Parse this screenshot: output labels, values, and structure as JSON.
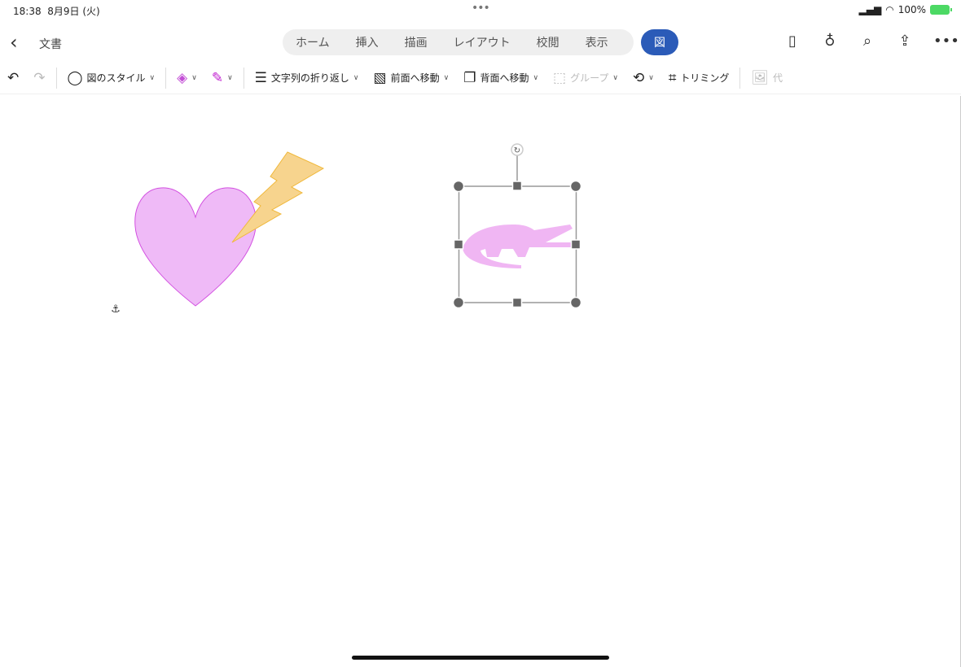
{
  "status": {
    "time": "18:38",
    "date": "8月9日 (火)",
    "battery": "100%"
  },
  "header": {
    "doc_title": "文書",
    "tabs": [
      "ホーム",
      "挿入",
      "描画",
      "レイアウト",
      "校閲",
      "表示"
    ],
    "active_tab": "図",
    "accent": "#2b5bb8"
  },
  "ribbon": {
    "picture_style": "図のスタイル",
    "wrap_text": "文字列の折り返し",
    "bring_forward": "前面へ移動",
    "send_backward": "背面へ移動",
    "group": "グループ",
    "crop": "トリミング",
    "alt_text": "代"
  },
  "canvas": {
    "heart_color": "#efbaf7",
    "heart_stroke": "#d24fe0",
    "bolt_color": "#f7d48e",
    "bolt_stroke": "#f0b83a",
    "crocodile_color": "#f0b6f3",
    "crocodile_selected": true
  }
}
